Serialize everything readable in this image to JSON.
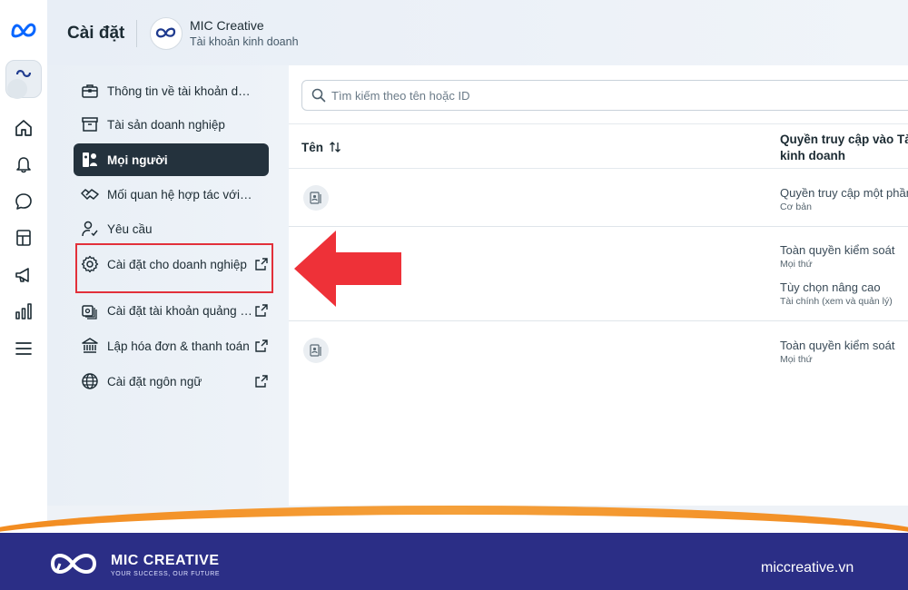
{
  "header": {
    "title": "Cài đặt",
    "business_name": "MIC Creative",
    "business_type": "Tài khoản kinh doanh"
  },
  "rail": {
    "items": [
      "home-icon",
      "bell-icon",
      "chat-icon",
      "pages-icon",
      "megaphone-icon",
      "chart-icon",
      "menu-icon"
    ]
  },
  "nav": {
    "items": [
      {
        "label": "Thông tin về tài khoản doanh nghiệp",
        "icon": "briefcase-icon",
        "external": false,
        "active": false
      },
      {
        "label": "Tài sản doanh nghiệp",
        "icon": "archive-icon",
        "external": false,
        "active": false
      },
      {
        "label": "Mọi người",
        "icon": "people-icon",
        "external": false,
        "active": true
      },
      {
        "label": "Mối quan hệ hợp tác với đối tác",
        "icon": "handshake-icon",
        "external": false,
        "active": false
      },
      {
        "label": "Yêu cầu",
        "icon": "person-check-icon",
        "external": false,
        "active": false
      },
      {
        "label": "Cài đặt cho doanh nghiệp",
        "icon": "gear-icon",
        "external": true,
        "active": false
      },
      {
        "label": "Cài đặt tài khoản quảng cáo",
        "icon": "ad-account-icon",
        "external": true,
        "active": false
      },
      {
        "label": "Lập hóa đơn & thanh toán",
        "icon": "bank-icon",
        "external": true,
        "active": false
      },
      {
        "label": "Cài đặt ngôn ngữ",
        "icon": "globe-icon",
        "external": true,
        "active": false
      }
    ]
  },
  "main": {
    "search_placeholder": "Tìm kiếm theo tên hoặc ID",
    "columns": {
      "name": "Tên",
      "access": "Quyền truy cập vào Tài\nkinh doanh"
    },
    "rows": [
      {
        "permissions": [
          {
            "main": "Quyền truy cập một phần",
            "sub": "Cơ bản"
          }
        ]
      },
      {
        "permissions": [
          {
            "main": "Toàn quyền kiểm soát",
            "sub": "Mọi thứ"
          },
          {
            "main": "Tùy chọn nâng cao",
            "sub": "Tài chính (xem và quản lý)"
          }
        ]
      },
      {
        "permissions": [
          {
            "main": "Toàn quyền kiểm soát",
            "sub": "Mọi thứ"
          }
        ]
      }
    ]
  },
  "footer": {
    "brand": "MIC CREATIVE",
    "slogan": "YOUR SUCCESS, OUR FUTURE",
    "website": "miccreative.vn"
  },
  "colors": {
    "active_nav": "#24323d",
    "highlight": "#e2303a",
    "footer_navy": "#2b2e86",
    "footer_orange": "#f28a1e",
    "meta_blue": "#0866ff"
  }
}
